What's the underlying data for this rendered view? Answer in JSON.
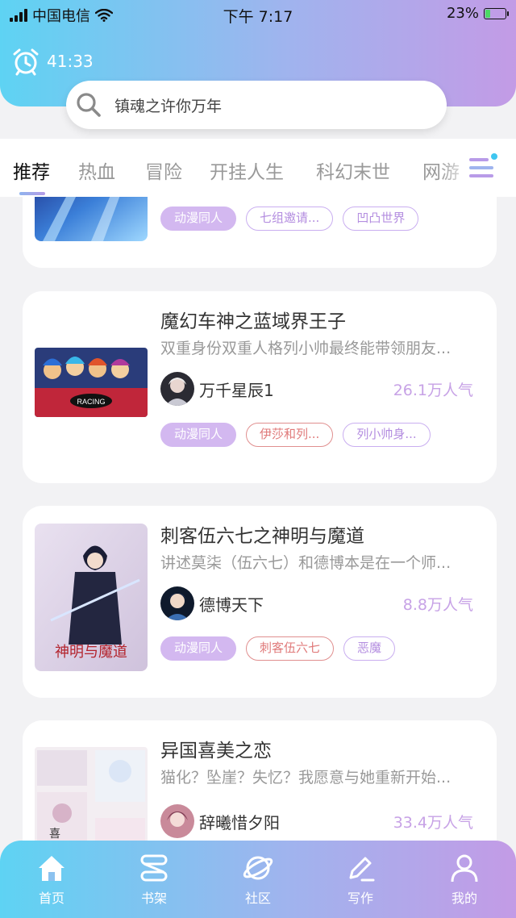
{
  "status": {
    "carrier": "中国电信",
    "time": "下午 7:17",
    "battery_text": "23%",
    "battery_level": 0.23
  },
  "timer": {
    "label": "41:33"
  },
  "search": {
    "placeholder": "镇魂之许你万年"
  },
  "tabs": [
    {
      "label": "推荐",
      "active": true
    },
    {
      "label": "热血"
    },
    {
      "label": "冒险"
    },
    {
      "label": "开挂人生"
    },
    {
      "label": "科幻末世"
    },
    {
      "label": "网游"
    }
  ],
  "books": [
    {
      "title": "",
      "tags": [
        {
          "label": "动漫同人",
          "style": "solid"
        },
        {
          "label": "七组邀请...",
          "style": "purple"
        },
        {
          "label": "凹凸世界",
          "style": "purple"
        }
      ]
    },
    {
      "title": "魔幻车神之蓝域界王子",
      "desc": "双重身份双重人格列小帅最终能带领朋友...",
      "author": "万千星辰1",
      "popularity": "26.1万人气",
      "cover_text": "RACING",
      "tags": [
        {
          "label": "动漫同人",
          "style": "solid"
        },
        {
          "label": "伊莎和列...",
          "style": "red"
        },
        {
          "label": "列小帅身...",
          "style": "purple"
        }
      ]
    },
    {
      "title": "刺客伍六七之神明与魔道",
      "desc": "讲述莫柒（伍六七）和德博本是在一个师...",
      "author": "德博天下",
      "popularity": "8.8万人气",
      "cover_text": "神明与魔道",
      "tags": [
        {
          "label": "动漫同人",
          "style": "solid"
        },
        {
          "label": "刺客伍六七",
          "style": "red"
        },
        {
          "label": "恶魔",
          "style": "purple"
        }
      ]
    },
    {
      "title": "异国喜美之恋",
      "desc": "猫化？坠崖？失忆？我愿意与她重新开始...",
      "author": "辞曦惜夕阳",
      "popularity": "33.4万人气",
      "cover_text": "喜"
    }
  ],
  "nav": [
    {
      "label": "首页",
      "icon": "home-icon",
      "active": true
    },
    {
      "label": "书架",
      "icon": "bookshelf-icon"
    },
    {
      "label": "社区",
      "icon": "planet-icon"
    },
    {
      "label": "写作",
      "icon": "pen-icon"
    },
    {
      "label": "我的",
      "icon": "user-icon"
    }
  ]
}
